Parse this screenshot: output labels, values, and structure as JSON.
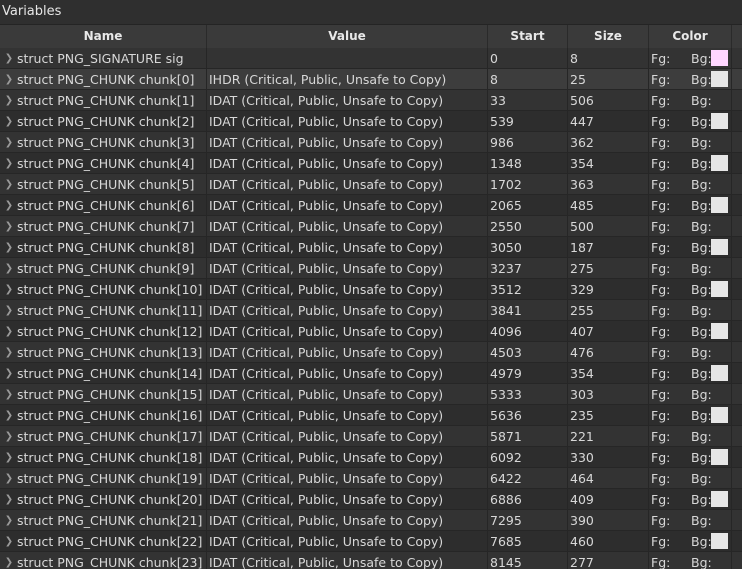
{
  "panel": {
    "title": "Variables"
  },
  "columns": [
    "Name",
    "Value",
    "Start",
    "Size",
    "Color"
  ],
  "colors": {
    "sig_bg": "#ffd6ff",
    "chunk_bg": "#e6e6e6"
  },
  "rows": [
    {
      "name": "struct PNG_SIGNATURE sig",
      "value": "",
      "start": "0",
      "size": "8",
      "fg": "Fg:",
      "bg": "Bg:",
      "swatch": "#ffd6ff"
    },
    {
      "name": "struct PNG_CHUNK chunk[0]",
      "value": "IHDR  (Critical, Public, Unsafe to Copy)",
      "start": "8",
      "size": "25",
      "fg": "Fg:",
      "bg": "Bg:",
      "swatch": "#e6e6e6"
    },
    {
      "name": "struct PNG_CHUNK chunk[1]",
      "value": "IDAT  (Critical, Public, Unsafe to Copy)",
      "start": "33",
      "size": "506",
      "fg": "Fg:",
      "bg": "Bg:",
      "swatch": ""
    },
    {
      "name": "struct PNG_CHUNK chunk[2]",
      "value": "IDAT  (Critical, Public, Unsafe to Copy)",
      "start": "539",
      "size": "447",
      "fg": "Fg:",
      "bg": "Bg:",
      "swatch": "#e6e6e6"
    },
    {
      "name": "struct PNG_CHUNK chunk[3]",
      "value": "IDAT  (Critical, Public, Unsafe to Copy)",
      "start": "986",
      "size": "362",
      "fg": "Fg:",
      "bg": "Bg:",
      "swatch": ""
    },
    {
      "name": "struct PNG_CHUNK chunk[4]",
      "value": "IDAT  (Critical, Public, Unsafe to Copy)",
      "start": "1348",
      "size": "354",
      "fg": "Fg:",
      "bg": "Bg:",
      "swatch": "#e6e6e6"
    },
    {
      "name": "struct PNG_CHUNK chunk[5]",
      "value": "IDAT  (Critical, Public, Unsafe to Copy)",
      "start": "1702",
      "size": "363",
      "fg": "Fg:",
      "bg": "Bg:",
      "swatch": ""
    },
    {
      "name": "struct PNG_CHUNK chunk[6]",
      "value": "IDAT  (Critical, Public, Unsafe to Copy)",
      "start": "2065",
      "size": "485",
      "fg": "Fg:",
      "bg": "Bg:",
      "swatch": "#e6e6e6"
    },
    {
      "name": "struct PNG_CHUNK chunk[7]",
      "value": "IDAT  (Critical, Public, Unsafe to Copy)",
      "start": "2550",
      "size": "500",
      "fg": "Fg:",
      "bg": "Bg:",
      "swatch": ""
    },
    {
      "name": "struct PNG_CHUNK chunk[8]",
      "value": "IDAT  (Critical, Public, Unsafe to Copy)",
      "start": "3050",
      "size": "187",
      "fg": "Fg:",
      "bg": "Bg:",
      "swatch": "#e6e6e6"
    },
    {
      "name": "struct PNG_CHUNK chunk[9]",
      "value": "IDAT  (Critical, Public, Unsafe to Copy)",
      "start": "3237",
      "size": "275",
      "fg": "Fg:",
      "bg": "Bg:",
      "swatch": ""
    },
    {
      "name": "struct PNG_CHUNK chunk[10]",
      "value": "IDAT  (Critical, Public, Unsafe to Copy)",
      "start": "3512",
      "size": "329",
      "fg": "Fg:",
      "bg": "Bg:",
      "swatch": "#e6e6e6"
    },
    {
      "name": "struct PNG_CHUNK chunk[11]",
      "value": "IDAT  (Critical, Public, Unsafe to Copy)",
      "start": "3841",
      "size": "255",
      "fg": "Fg:",
      "bg": "Bg:",
      "swatch": ""
    },
    {
      "name": "struct PNG_CHUNK chunk[12]",
      "value": "IDAT  (Critical, Public, Unsafe to Copy)",
      "start": "4096",
      "size": "407",
      "fg": "Fg:",
      "bg": "Bg:",
      "swatch": "#e6e6e6"
    },
    {
      "name": "struct PNG_CHUNK chunk[13]",
      "value": "IDAT  (Critical, Public, Unsafe to Copy)",
      "start": "4503",
      "size": "476",
      "fg": "Fg:",
      "bg": "Bg:",
      "swatch": ""
    },
    {
      "name": "struct PNG_CHUNK chunk[14]",
      "value": "IDAT  (Critical, Public, Unsafe to Copy)",
      "start": "4979",
      "size": "354",
      "fg": "Fg:",
      "bg": "Bg:",
      "swatch": "#e6e6e6"
    },
    {
      "name": "struct PNG_CHUNK chunk[15]",
      "value": "IDAT  (Critical, Public, Unsafe to Copy)",
      "start": "5333",
      "size": "303",
      "fg": "Fg:",
      "bg": "Bg:",
      "swatch": ""
    },
    {
      "name": "struct PNG_CHUNK chunk[16]",
      "value": "IDAT  (Critical, Public, Unsafe to Copy)",
      "start": "5636",
      "size": "235",
      "fg": "Fg:",
      "bg": "Bg:",
      "swatch": "#e6e6e6"
    },
    {
      "name": "struct PNG_CHUNK chunk[17]",
      "value": "IDAT  (Critical, Public, Unsafe to Copy)",
      "start": "5871",
      "size": "221",
      "fg": "Fg:",
      "bg": "Bg:",
      "swatch": ""
    },
    {
      "name": "struct PNG_CHUNK chunk[18]",
      "value": "IDAT  (Critical, Public, Unsafe to Copy)",
      "start": "6092",
      "size": "330",
      "fg": "Fg:",
      "bg": "Bg:",
      "swatch": "#e6e6e6"
    },
    {
      "name": "struct PNG_CHUNK chunk[19]",
      "value": "IDAT  (Critical, Public, Unsafe to Copy)",
      "start": "6422",
      "size": "464",
      "fg": "Fg:",
      "bg": "Bg:",
      "swatch": ""
    },
    {
      "name": "struct PNG_CHUNK chunk[20]",
      "value": "IDAT  (Critical, Public, Unsafe to Copy)",
      "start": "6886",
      "size": "409",
      "fg": "Fg:",
      "bg": "Bg:",
      "swatch": "#e6e6e6"
    },
    {
      "name": "struct PNG_CHUNK chunk[21]",
      "value": "IDAT  (Critical, Public, Unsafe to Copy)",
      "start": "7295",
      "size": "390",
      "fg": "Fg:",
      "bg": "Bg:",
      "swatch": ""
    },
    {
      "name": "struct PNG_CHUNK chunk[22]",
      "value": "IDAT  (Critical, Public, Unsafe to Copy)",
      "start": "7685",
      "size": "460",
      "fg": "Fg:",
      "bg": "Bg:",
      "swatch": "#e6e6e6"
    },
    {
      "name": "struct PNG_CHUNK chunk[23]",
      "value": "IDAT  (Critical, Public, Unsafe to Copy)",
      "start": "8145",
      "size": "277",
      "fg": "Fg:",
      "bg": "Bg:",
      "swatch": ""
    }
  ]
}
